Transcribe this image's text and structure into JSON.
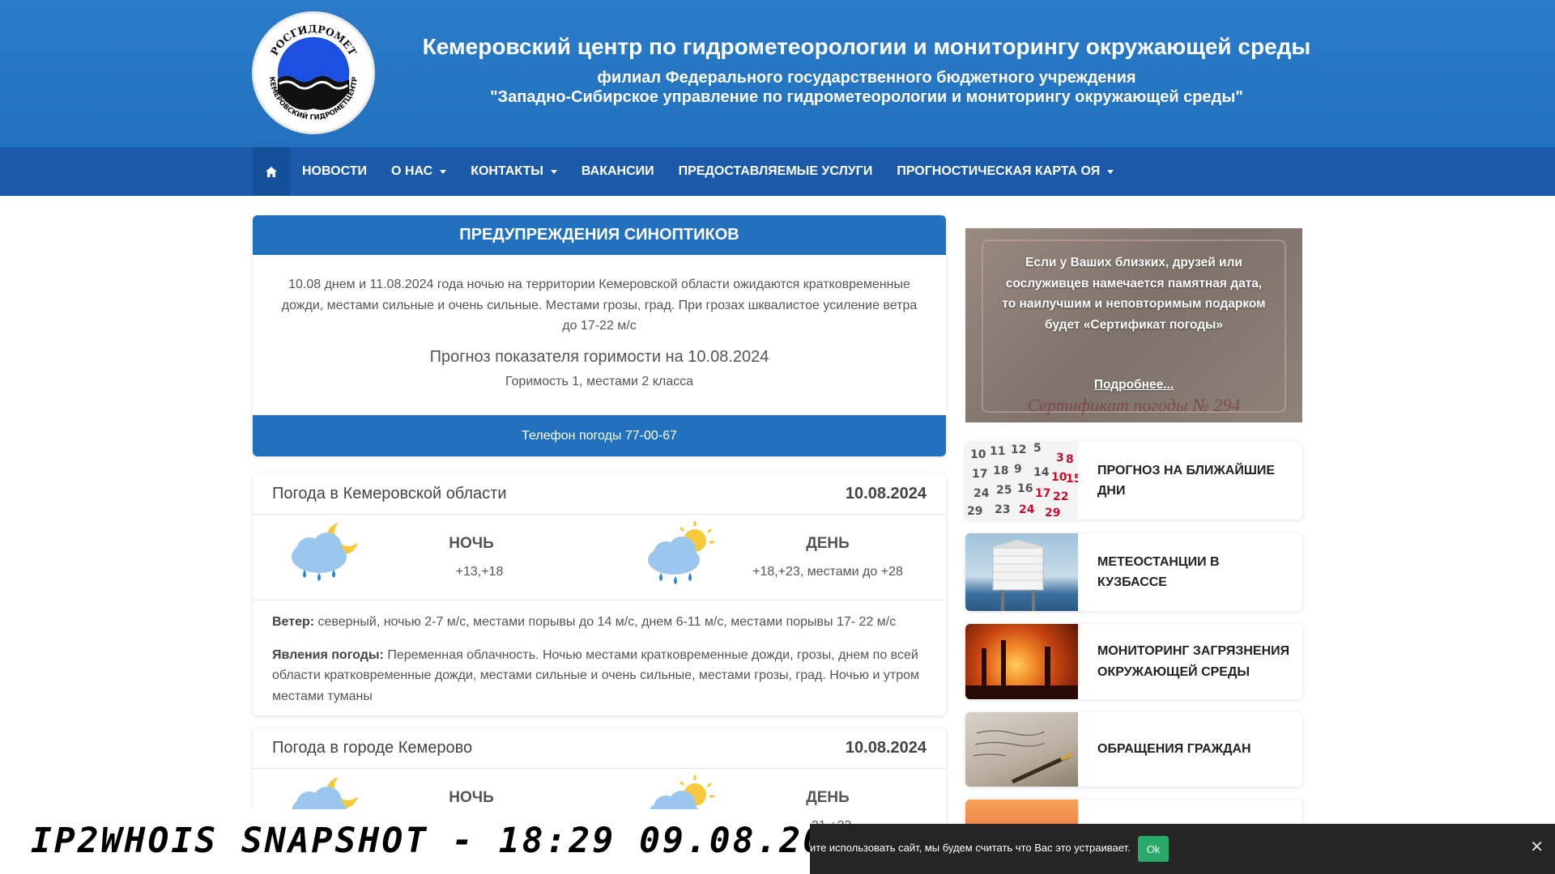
{
  "header": {
    "logo_text": "РОСГИДРОМЕТ КЕМЕРОВСКИЙ ГИДРОМЕТЦЕНТР",
    "title": "Кемеровский центр по гидрометеорологии и мониторингу окружающей среды",
    "subtitle_line1": "филиал Федерального государственного бюджетного учреждения",
    "subtitle_line2": "\"Западно-Сибирское управление по гидрометеорологии и мониторингу окружающей среды\""
  },
  "nav": {
    "home_icon": "home-icon",
    "items": [
      {
        "label": "НОВОСТИ",
        "dropdown": false
      },
      {
        "label": "О НАС",
        "dropdown": true
      },
      {
        "label": "КОНТАКТЫ",
        "dropdown": true
      },
      {
        "label": "ВАКАНСИИ",
        "dropdown": false
      },
      {
        "label": "ПРЕДОСТАВЛЯЕМЫЕ УСЛУГИ",
        "dropdown": false
      },
      {
        "label": "ПРОГНОСТИЧЕСКАЯ КАРТА ОЯ",
        "dropdown": true
      }
    ]
  },
  "warnings": {
    "heading": "ПРЕДУПРЕЖДЕНИЯ СИНОПТИКОВ",
    "text": "10.08 днем и 11.08.2024 года ночью на территории Кемеровской области ожидаются кратковременные дожди, местами сильные и очень сильные. Местами грозы, град. При грозах шквалистое усиление ветра до 17-22 м/с",
    "fire_title": "Прогноз показателя горимости на 10.08.2024",
    "fire_text": "Горимость 1, местами 2 класса",
    "phone": "Телефон погоды 77-00-67"
  },
  "weather_region": {
    "title": "Погода в Кемеровской области",
    "date": "10.08.2024",
    "night_label": "НОЧЬ",
    "night_temp": "+13,+18",
    "night_icon": "cloud-moon-rain-icon",
    "day_label": "ДЕНЬ",
    "day_temp": "+18,+23, местами до +28",
    "day_icon": "cloud-sun-rain-icon",
    "wind_label": "Ветер:",
    "wind_text": "северный, ночью 2-7 м/с, местами порывы до 14 м/с, днем 6-11 м/с, местами порывы 17- 22 м/с",
    "phenomena_label": "Явления погоды:",
    "phenomena_text": "Переменная облачность. Ночью местами кратковременные дожди, грозы, днем по всей области кратковременные дожди, местами сильные и очень сильные, местами грозы, град. Ночью и утром местами туманы"
  },
  "weather_city": {
    "title": "Погода в городе Кемерово",
    "date": "10.08.2024",
    "night_label": "НОЧЬ",
    "day_label": "ДЕНЬ",
    "day_temp": "+21,+23",
    "night_icon": "cloud-moon-icon",
    "day_icon": "cloud-sun-icon"
  },
  "promo": {
    "text": "Если у Ваших близких, друзей или сослуживцев намечается памятная дата, то наилучшим и неповторимым подарком будет «Сертификат погоды»",
    "link": "Подробнее...",
    "number": "Сертификат погоды № 294"
  },
  "sidebar": [
    {
      "label": "ПРОГНОЗ НА БЛИЖАЙШИЕ ДНИ",
      "thumb": "calendar-image"
    },
    {
      "label": "МЕТЕОСТАНЦИИ В КУЗБАССЕ",
      "thumb": "weather-station-image"
    },
    {
      "label": "МОНИТОРИНГ ЗАГРЯЗНЕНИЯ ОКРУЖАЮЩЕЙ СРЕДЫ",
      "thumb": "factory-smoke-image"
    },
    {
      "label": "ОБРАЩЕНИЯ ГРАЖДАН",
      "thumb": "letter-pen-image"
    }
  ],
  "snapshot": {
    "text": "IP2WHOIS SNAPSHOT - 18:29 09.08.2024"
  },
  "cookie": {
    "text": "ите использовать сайт, мы будем считать что Вас это устраивает.",
    "ok": "Ok",
    "close_icon": "close-icon"
  },
  "colors": {
    "header_blue": "#2171bf",
    "nav_blue": "#1a5aa8",
    "accent_green": "#2aaa6a"
  }
}
